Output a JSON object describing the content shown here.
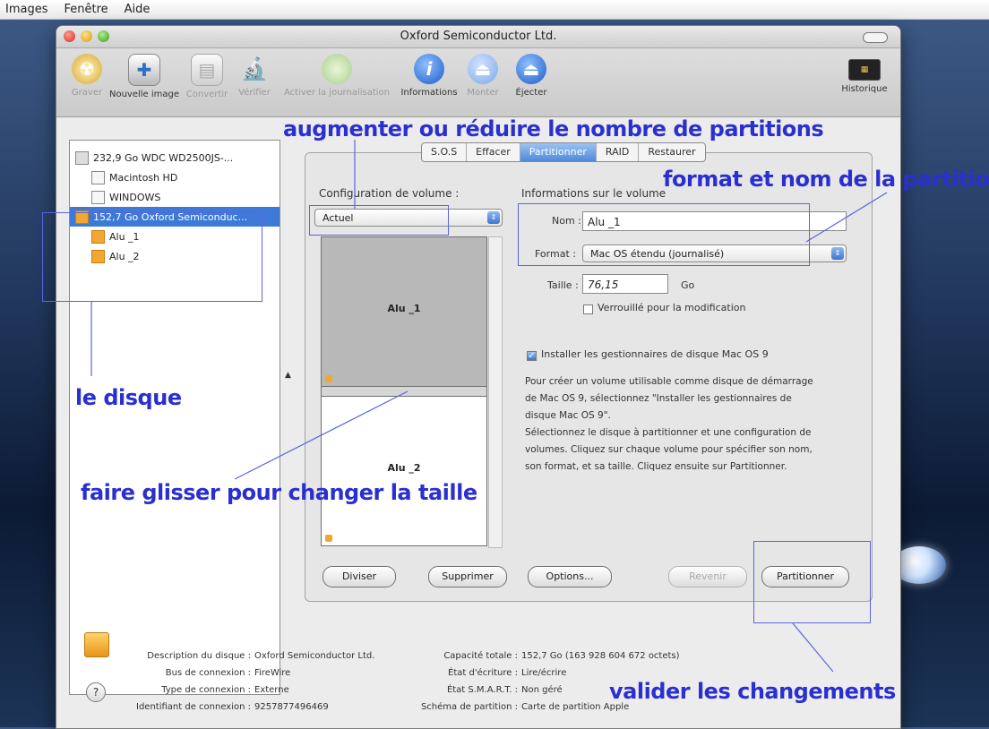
{
  "menubar": {
    "items": [
      "Images",
      "Fenêtre",
      "Aide"
    ]
  },
  "window": {
    "title": "Oxford Semiconductor Ltd."
  },
  "toolbar": {
    "items": [
      {
        "label": "Graver",
        "icon": "burn-icon",
        "enabled": false
      },
      {
        "label": "Nouvelle image",
        "icon": "new-image-icon",
        "enabled": true
      },
      {
        "label": "Convertir",
        "icon": "convert-icon",
        "enabled": false
      },
      {
        "label": "Vérifier",
        "icon": "microscope-icon",
        "enabled": false
      },
      {
        "label": "Activer la journalisation",
        "icon": "journaling-icon",
        "enabled": false
      },
      {
        "label": "Informations",
        "icon": "info-icon",
        "enabled": true
      },
      {
        "label": "Monter",
        "icon": "mount-icon",
        "enabled": false
      },
      {
        "label": "Éjecter",
        "icon": "eject-icon",
        "enabled": true
      }
    ],
    "history_label": "Historique"
  },
  "sidebar": {
    "items": [
      {
        "label": "232,9 Go WDC WD2500JS-..."
      },
      {
        "label": "Macintosh HD"
      },
      {
        "label": "WINDOWS"
      },
      {
        "label": "152,7 Go Oxford Semiconduc..."
      },
      {
        "label": "Alu _1"
      },
      {
        "label": "Alu _2"
      }
    ]
  },
  "tabs": [
    "S.O.S",
    "Effacer",
    "Partitionner",
    "RAID",
    "Restaurer"
  ],
  "partition": {
    "config_label": "Configuration de volume :",
    "config_value": "Actuel",
    "info_label": "Informations sur le volume",
    "name_label": "Nom :",
    "name_value": "Alu _1",
    "format_label": "Format :",
    "format_value": "Mac OS étendu (journalisé)",
    "size_label": "Taille :",
    "size_value": "76,15",
    "size_unit": "Go",
    "lock_label": "Verrouillé pour la modification",
    "install_label": "Installer les gestionnaires de disque Mac OS 9",
    "help_lines": [
      "Pour créer un volume utilisable comme disque de démarrage",
      "de Mac OS 9, sélectionnez \"Installer les gestionnaires de",
      "disque Mac OS 9\".",
      "Sélectionnez le disque à partitionner et une configuration de",
      "volumes. Cliquez sur chaque volume pour spécifier son nom,",
      "son format, et sa taille. Cliquez ensuite sur Partitionner."
    ],
    "volumes": [
      {
        "name": "Alu _1"
      },
      {
        "name": "Alu _2"
      }
    ],
    "buttons": {
      "split": "Diviser",
      "delete": "Supprimer",
      "options": "Options...",
      "revert": "Revenir",
      "partition": "Partitionner"
    }
  },
  "disk_info": {
    "description_key": "Description du disque :",
    "description_val": "Oxford Semiconductor Ltd.",
    "bus_key": "Bus de connexion :",
    "bus_val": "FireWire",
    "type_key": "Type de connexion :",
    "type_val": "Externe",
    "id_key": "Identifiant de connexion :",
    "id_val": "9257877496469",
    "capacity_key": "Capacité totale :",
    "capacity_val": "152,7 Go (163 928 604 672 octets)",
    "write_key": "État d'écriture :",
    "write_val": "Lire/écrire",
    "smart_key": "État S.M.A.R.T. :",
    "smart_val": "Non géré",
    "scheme_key": "Schéma de partition :",
    "scheme_val": "Carte de partition Apple"
  },
  "annotations": {
    "partitions": "augmenter ou réduire le nombre de partitions",
    "format": "format et nom de la partition",
    "disk": "le disque",
    "drag": "faire glisser pour changer la taille",
    "validate": "valider les changements"
  },
  "colors": {
    "annotation": "#2a2fd0",
    "selection": "#3d7ad8"
  }
}
